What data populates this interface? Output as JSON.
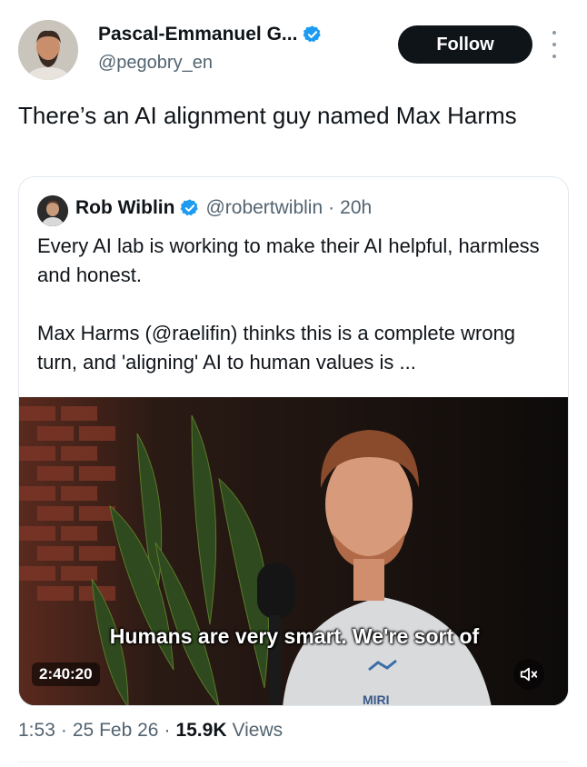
{
  "author": {
    "name": "Pascal-Emmanuel G...",
    "handle": "@pegobry_en"
  },
  "follow_label": "Follow",
  "tweet_text": "There’s an AI alignment guy named Max Harms",
  "quote": {
    "name": "Rob Wiblin",
    "handle": "@robertwiblin",
    "separator": "·",
    "time": "20h",
    "paragraph1": "Every AI lab is working to make their AI helpful, harmless and honest.",
    "paragraph2": "Max Harms (@raelifin) thinks this is a complete wrong turn, and 'aligning' AI to human values is ...",
    "media": {
      "caption": "Humans are very smart. We're sort of",
      "duration": "2:40:20",
      "shirt_logo": "MIRI",
      "mute_icon": "speaker-muted-icon"
    }
  },
  "meta": {
    "time": "1:53",
    "date": "25 Feb 26",
    "separator": "·",
    "views_count": "15.9K",
    "views_label": "Views"
  },
  "colors": {
    "verified": "#1d9bf0",
    "follow_bg": "#0f1419",
    "secondary_text": "#536471"
  }
}
